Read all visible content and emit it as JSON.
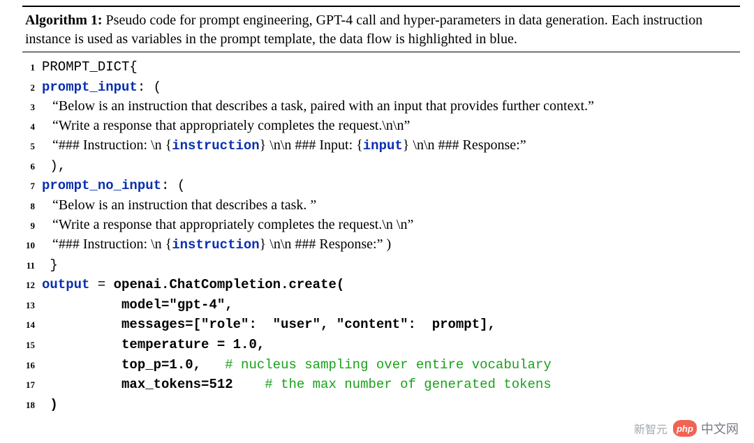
{
  "algorithm": {
    "label": "Algorithm 1:",
    "caption": "Pseudo code for prompt engineering, GPT-4 call and hyper-parameters in data generation. Each instruction instance is used as variables in the prompt template, the data flow is highlighted in blue."
  },
  "lines": {
    "l1": {
      "num": "1",
      "a": "PROMPT_DICT{"
    },
    "l2": {
      "num": "2",
      "a": "prompt_input",
      "b": ": ("
    },
    "l3": {
      "num": "3",
      "a": "   “Below is an instruction that describes a task, paired with an input that provides further context.”"
    },
    "l4": {
      "num": "4",
      "a": "   “Write a response that appropriately completes the request.\\n\\n”"
    },
    "l5": {
      "num": "5",
      "a": "   “### Instruction: \\n {",
      "b": "instruction",
      "c": "} \\n\\n ### Input: {",
      "d": "input",
      "e": "} \\n\\n ### Response:”"
    },
    "l6": {
      "num": "6",
      "a": " ),"
    },
    "l7": {
      "num": "7",
      "a": "prompt_no_input",
      "b": ": ("
    },
    "l8": {
      "num": "8",
      "a": "   “Below is an instruction that describes a task. ”"
    },
    "l9": {
      "num": "9",
      "a": "   “Write a response that appropriately completes the request.\\n \\n”"
    },
    "l10": {
      "num": "10",
      "a": "   “### Instruction: \\n {",
      "b": "instruction",
      "c": "} \\n\\n ### Response:” )"
    },
    "l11": {
      "num": "11",
      "a": " }"
    },
    "l12": {
      "num": "12",
      "a": "output",
      "b": " = ",
      "c": "openai.ChatCompletion.create("
    },
    "l13": {
      "num": "13",
      "a": "          model=\"gpt-4\","
    },
    "l14": {
      "num": "14",
      "a": "          messages=[\"role\":  \"user\", \"content\":  prompt],"
    },
    "l15": {
      "num": "15",
      "a": "          temperature = 1.0,"
    },
    "l16": {
      "num": "16",
      "a": "          top_p=1.0,",
      "b": "   # nucleus sampling over entire vocabulary"
    },
    "l17": {
      "num": "17",
      "a": "          max_tokens=512",
      "b": "    # the max number of generated tokens"
    },
    "l18": {
      "num": "18",
      "a": " )"
    }
  },
  "watermark": {
    "left": "新智元",
    "php": "php",
    "right": "中文网"
  }
}
